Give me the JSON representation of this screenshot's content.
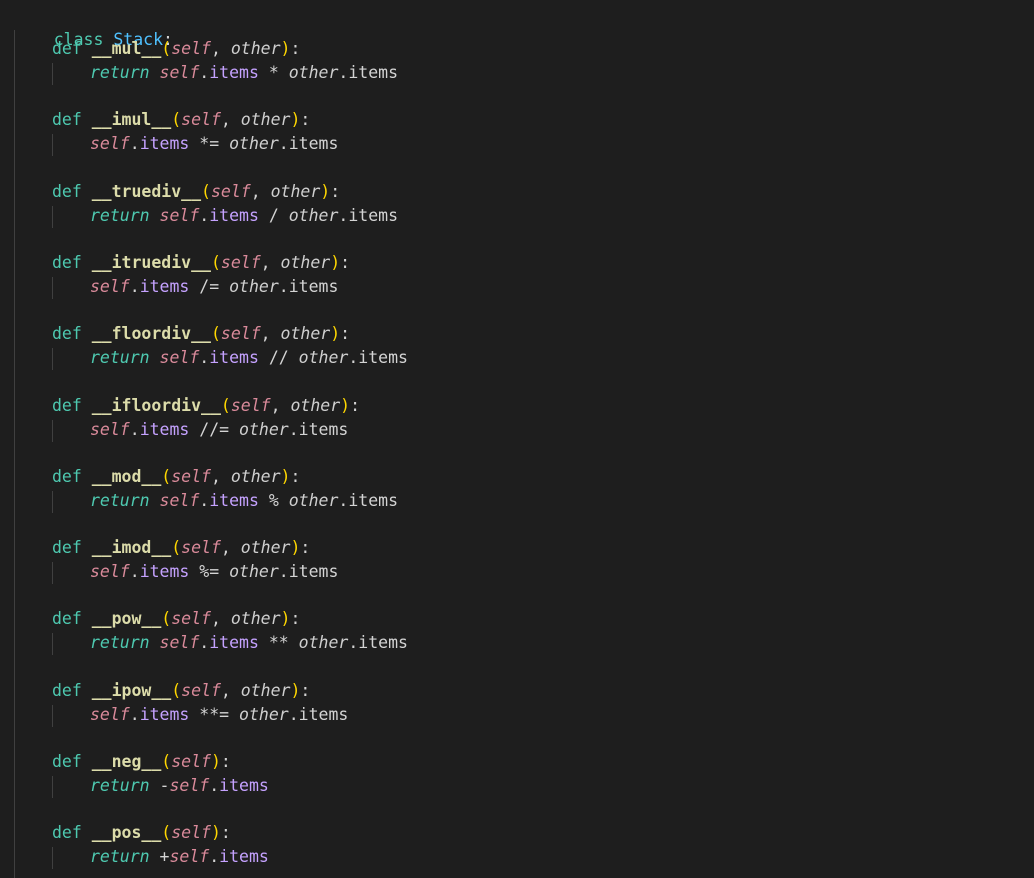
{
  "editor": {
    "class_line": {
      "keyword": "class",
      "name": "Stack",
      "colon": ":"
    },
    "methods": [
      {
        "name": "__mul__",
        "params": [
          "self",
          "other"
        ],
        "body": {
          "kind": "return",
          "text": "return",
          "self": "self",
          "attr": "items",
          "op": " * ",
          "other": "other",
          "other_attr": "items"
        }
      },
      {
        "name": "__imul__",
        "params": [
          "self",
          "other"
        ],
        "body": {
          "kind": "assign",
          "self": "self",
          "attr": "items",
          "op": " *= ",
          "other": "other",
          "other_attr": "items"
        }
      },
      {
        "name": "__truediv__",
        "params": [
          "self",
          "other"
        ],
        "body": {
          "kind": "return",
          "text": "return",
          "self": "self",
          "attr": "items",
          "op": " / ",
          "other": "other",
          "other_attr": "items"
        }
      },
      {
        "name": "__itruediv__",
        "params": [
          "self",
          "other"
        ],
        "body": {
          "kind": "assign",
          "self": "self",
          "attr": "items",
          "op": " /= ",
          "other": "other",
          "other_attr": "items"
        }
      },
      {
        "name": "__floordiv__",
        "params": [
          "self",
          "other"
        ],
        "body": {
          "kind": "return",
          "text": "return",
          "self": "self",
          "attr": "items",
          "op": " // ",
          "other": "other",
          "other_attr": "items"
        }
      },
      {
        "name": "__ifloordiv__",
        "params": [
          "self",
          "other"
        ],
        "body": {
          "kind": "assign",
          "self": "self",
          "attr": "items",
          "op": " //= ",
          "other": "other",
          "other_attr": "items"
        }
      },
      {
        "name": "__mod__",
        "params": [
          "self",
          "other"
        ],
        "body": {
          "kind": "return",
          "text": "return",
          "self": "self",
          "attr": "items",
          "op": " % ",
          "other": "other",
          "other_attr": "items"
        }
      },
      {
        "name": "__imod__",
        "params": [
          "self",
          "other"
        ],
        "body": {
          "kind": "assign",
          "self": "self",
          "attr": "items",
          "op": " %= ",
          "other": "other",
          "other_attr": "items"
        }
      },
      {
        "name": "__pow__",
        "params": [
          "self",
          "other"
        ],
        "body": {
          "kind": "return",
          "text": "return",
          "self": "self",
          "attr": "items",
          "op": " ** ",
          "other": "other",
          "other_attr": "items"
        }
      },
      {
        "name": "__ipow__",
        "params": [
          "self",
          "other"
        ],
        "body": {
          "kind": "assign",
          "self": "self",
          "attr": "items",
          "op": " **= ",
          "other": "other",
          "other_attr": "items"
        }
      },
      {
        "name": "__neg__",
        "params": [
          "self"
        ],
        "body": {
          "kind": "unary",
          "text": "return",
          "op": " -",
          "self": "self",
          "attr": "items"
        }
      },
      {
        "name": "__pos__",
        "params": [
          "self"
        ],
        "body": {
          "kind": "unary",
          "text": "return",
          "op": " +",
          "self": "self",
          "attr": "items"
        }
      }
    ],
    "def_keyword": "def",
    "colors": {
      "background": "#1e1e1e",
      "keyword": "#4ec9b0",
      "class_name": "#4fc1ff",
      "function": "#dcdcaa",
      "self": "#d98a9a",
      "attribute": "#c5a2ff",
      "bracket_level1": "#ffd700",
      "bracket_level2": "#da70d6"
    }
  }
}
